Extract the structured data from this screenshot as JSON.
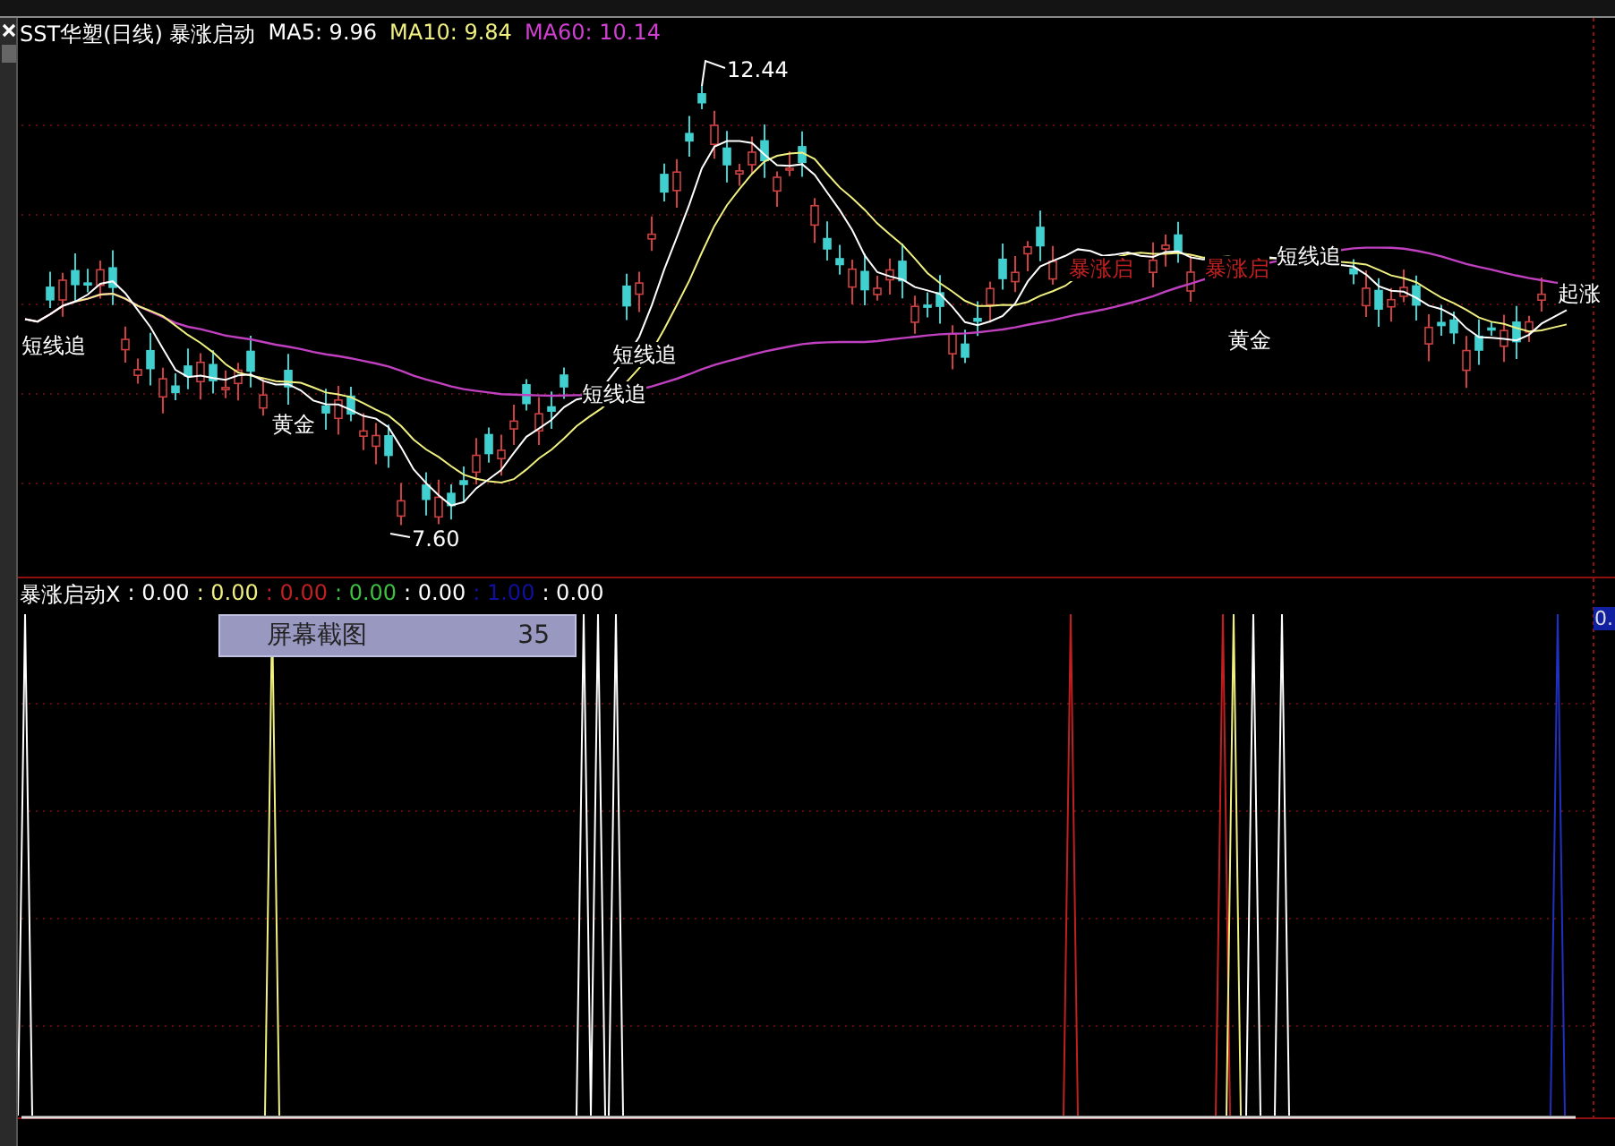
{
  "price_pane": {
    "title": [
      {
        "text": "SST华塑(日线) 暴涨启动",
        "color": "#ffffff"
      },
      {
        "text": "MA5: 9.96",
        "color": "#ffffff"
      },
      {
        "text": "MA10: 9.84",
        "color": "#f0f080"
      },
      {
        "text": "MA60: 10.14",
        "color": "#d040d0"
      }
    ],
    "high_label": "12.44",
    "low_label": "7.60",
    "signals": [
      {
        "text": "短线追",
        "color": "#ffffff"
      },
      {
        "text": "黄金",
        "color": "#ffffff"
      },
      {
        "text": "短线追",
        "color": "#ffffff"
      },
      {
        "text": "短线追",
        "color": "#ffffff"
      },
      {
        "text": "暴涨启",
        "color": "#c02020"
      },
      {
        "text": "暴涨启",
        "color": "#c02020"
      },
      {
        "text": "短线追",
        "color": "#ffffff"
      },
      {
        "text": "黄金",
        "color": "#ffffff"
      },
      {
        "text": "起涨",
        "color": "#ffffff"
      }
    ]
  },
  "indicator_pane": {
    "name": "暴涨启动X",
    "values": [
      {
        "text": ": 0.00",
        "color": "#ffffff"
      },
      {
        "text": ": 0.00",
        "color": "#f0f080"
      },
      {
        "text": ": 0.00",
        "color": "#c02020"
      },
      {
        "text": ": 0.00",
        "color": "#40c040"
      },
      {
        "text": ": 0.00",
        "color": "#ffffff"
      },
      {
        "text": ": 1.00",
        "color": "#1010a0"
      },
      {
        "text": ": 0.00",
        "color": "#ffffff"
      }
    ],
    "tooltip": {
      "label": "屏幕截图",
      "value": "35"
    },
    "value_tag": "0."
  }
}
